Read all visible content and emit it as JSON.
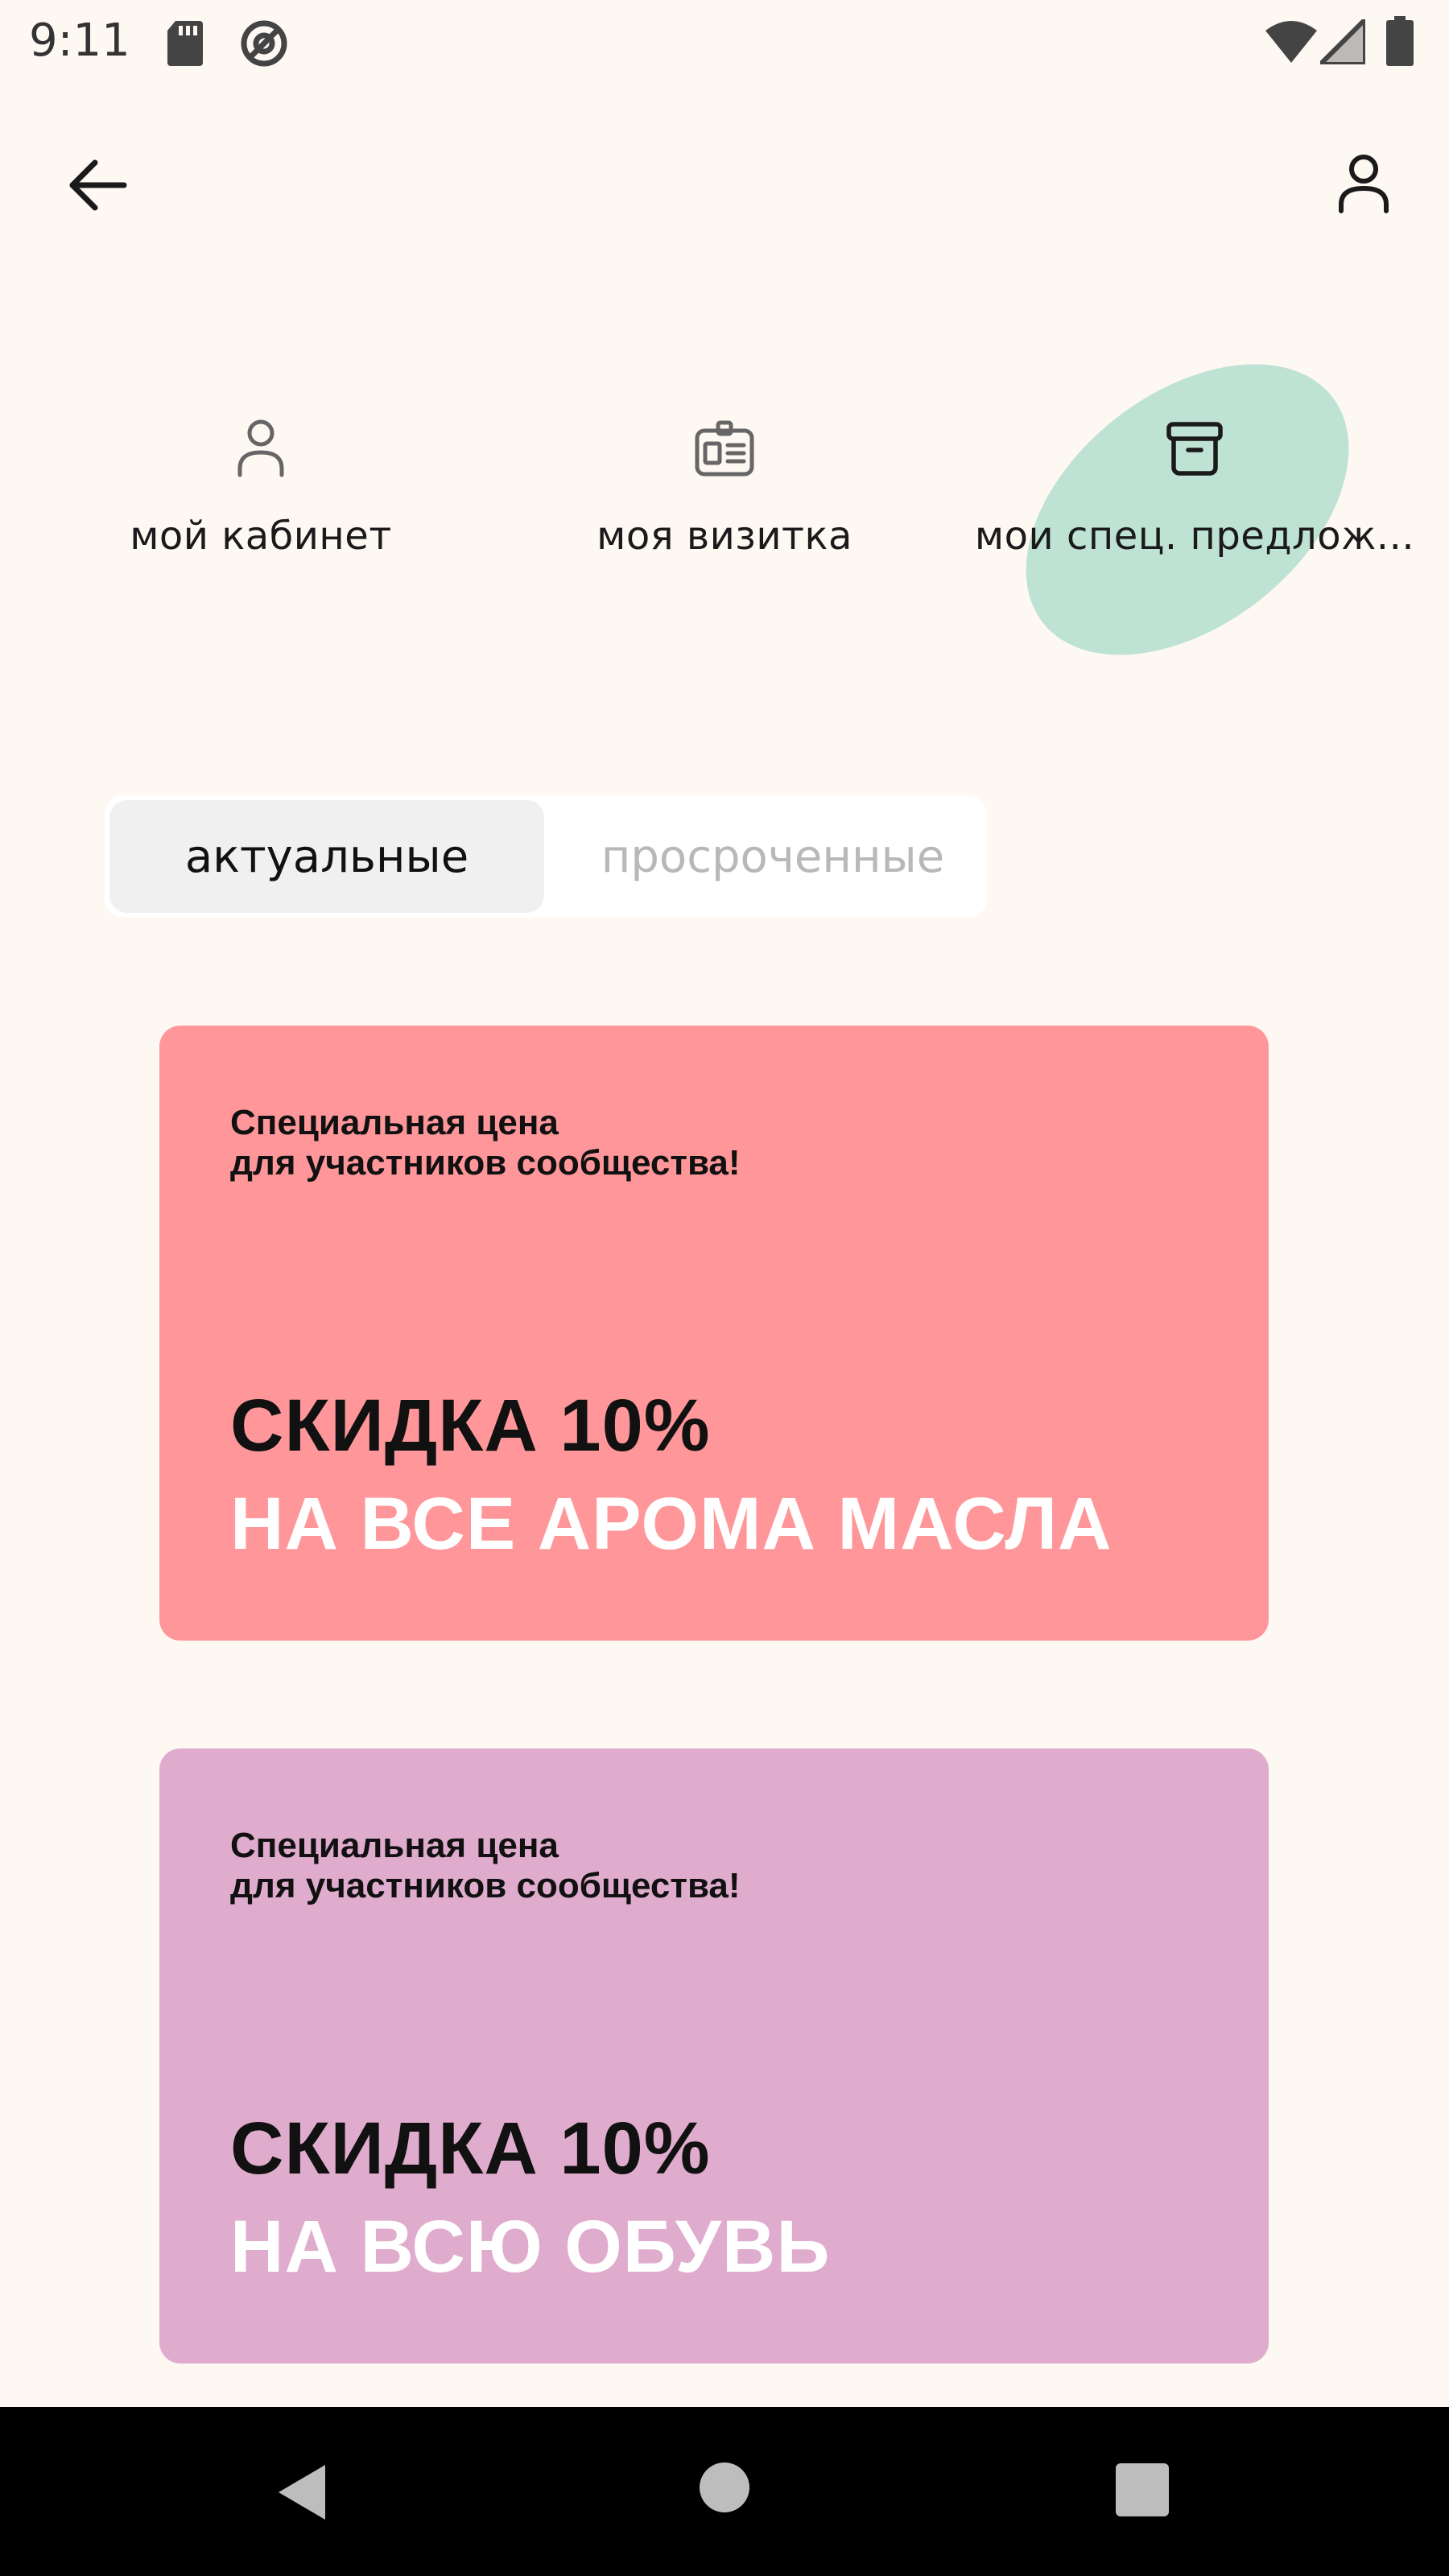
{
  "status_bar": {
    "time": "9:11",
    "icons": [
      "sd-card-icon",
      "sync-icon",
      "wifi-icon",
      "signal-icon",
      "battery-icon"
    ]
  },
  "top_bar": {
    "icons": [
      "back-arrow-icon",
      "profile-icon"
    ]
  },
  "nav": {
    "items": [
      {
        "label": "мой кабинет",
        "icon": "person-icon"
      },
      {
        "label": "моя визитка",
        "icon": "id-card-icon"
      },
      {
        "label": "мои спец. предлож...",
        "icon": "archive-box-icon",
        "selected": true
      }
    ],
    "highlight_color": "#BEE2D3"
  },
  "tabs": {
    "active": "актуальные",
    "inactive": "просроченные"
  },
  "offers": [
    {
      "subtitle": "Специальная цена\nдля участников сообщества!",
      "headline": "СКИДКА 10%",
      "detail": "НА ВСЕ АРОМА МАСЛА",
      "color": "#FF979A"
    },
    {
      "subtitle": "Специальная цена\nдля участников сообщества!",
      "headline": "СКИДКА 10%",
      "detail": "НА ВСЮ ОБУВЬ",
      "color": "#E0ACCD"
    }
  ],
  "system_nav": {
    "icons": [
      "nav-back-icon",
      "nav-home-icon",
      "nav-recents-icon"
    ]
  }
}
